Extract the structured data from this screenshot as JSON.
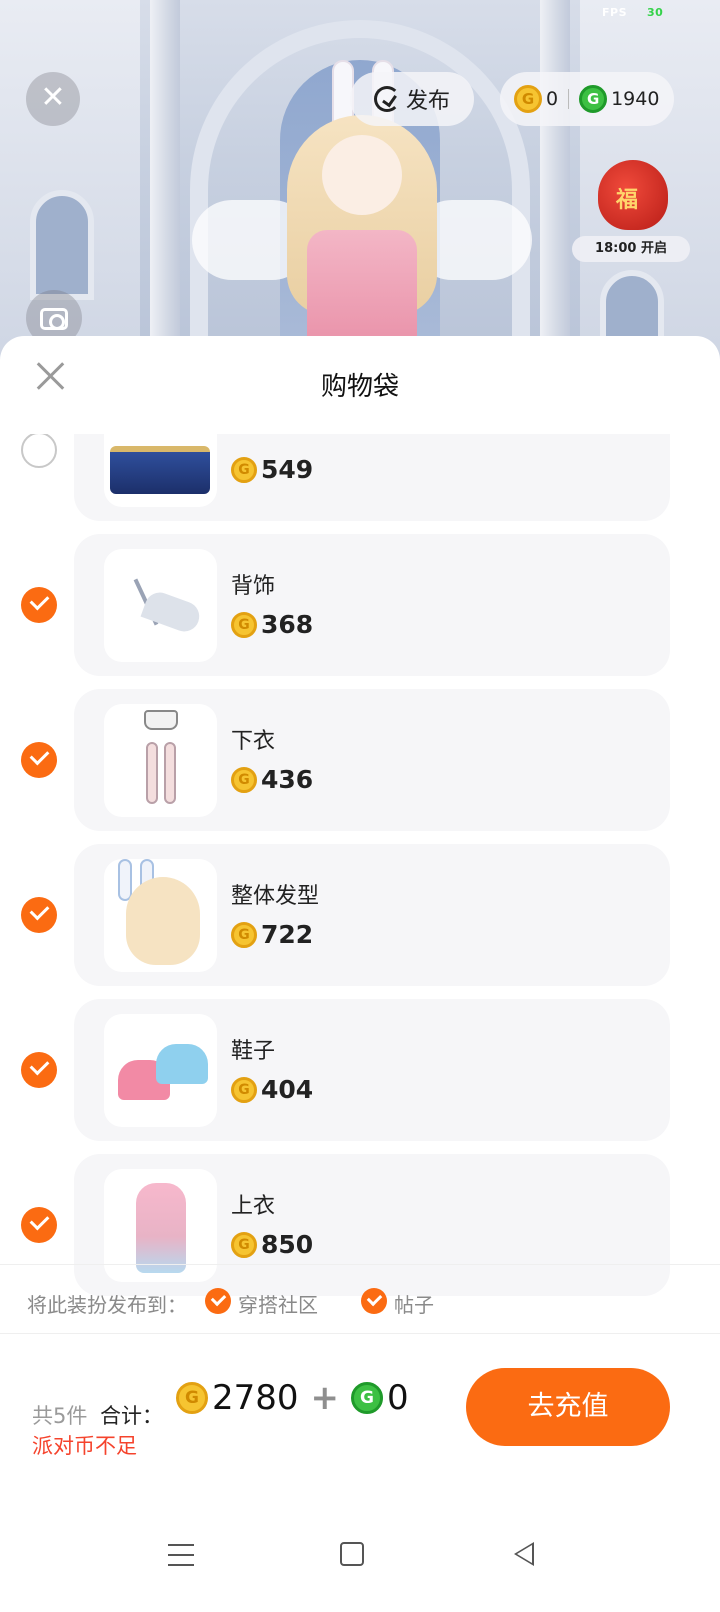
{
  "hud": {
    "fps_label": "FPS",
    "fps_value": "30",
    "close_icon": "close-icon",
    "publish_label": "发布",
    "party_coin_balance": "0",
    "g_coin_balance": "1940",
    "event_time": "18:00 开启",
    "event_badge": "福"
  },
  "sheet": {
    "title": "购物袋",
    "items": [
      {
        "name": "",
        "price": "549",
        "checked": false
      },
      {
        "name": "背饰",
        "price": "368",
        "checked": true
      },
      {
        "name": "下衣",
        "price": "436",
        "checked": true
      },
      {
        "name": "整体发型",
        "price": "722",
        "checked": true
      },
      {
        "name": "鞋子",
        "price": "404",
        "checked": true
      },
      {
        "name": "上衣",
        "price": "850",
        "checked": true
      }
    ],
    "publish": {
      "label": "将此装扮发布到：",
      "option_1": "穿搭社区",
      "option_2": "帖子"
    },
    "footer": {
      "count": "共5件",
      "total_label": "合计：",
      "party_total": "2780",
      "plus": "+",
      "g_total": "0",
      "warning": "派对币不足",
      "cta": "去充值"
    }
  },
  "colors": {
    "accent": "#fb6b12",
    "warning": "#f5432c",
    "card_bg": "#f6f6f8"
  }
}
